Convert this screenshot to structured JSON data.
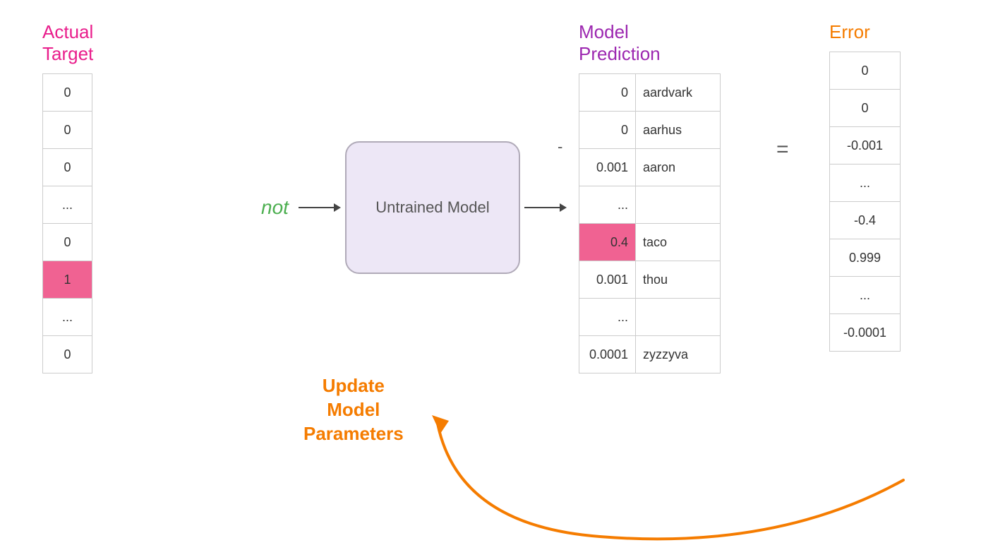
{
  "actualTarget": {
    "title": [
      "Actual",
      "Target"
    ],
    "rows": [
      {
        "value": "0",
        "highlighted": false
      },
      {
        "value": "0",
        "highlighted": false
      },
      {
        "value": "0",
        "highlighted": false
      },
      {
        "value": "...",
        "highlighted": false
      },
      {
        "value": "0",
        "highlighted": false
      },
      {
        "value": "1",
        "highlighted": true
      },
      {
        "value": "...",
        "highlighted": false
      },
      {
        "value": "0",
        "highlighted": false
      }
    ]
  },
  "model": {
    "inputWord": "not",
    "label": "Untrained Model"
  },
  "predictionHeader": [
    "Model",
    "Prediction"
  ],
  "predictionRows": [
    {
      "num": "0",
      "word": "aardvark",
      "highlighted": false
    },
    {
      "num": "0",
      "word": "aarhus",
      "highlighted": false
    },
    {
      "num": "0.001",
      "word": "aaron",
      "highlighted": false
    },
    {
      "num": "...",
      "word": "...",
      "highlighted": false
    },
    {
      "num": "0.4",
      "word": "taco",
      "highlighted": true
    },
    {
      "num": "0.001",
      "word": "thou",
      "highlighted": false
    },
    {
      "num": "...",
      "word": "...",
      "highlighted": false
    },
    {
      "num": "0.0001",
      "word": "zyzzyva",
      "highlighted": false
    }
  ],
  "errorHeader": "Error",
  "errorRows": [
    {
      "value": "0",
      "highlighted": false
    },
    {
      "value": "0",
      "highlighted": false
    },
    {
      "value": "-0.001",
      "highlighted": false
    },
    {
      "value": "...",
      "highlighted": false
    },
    {
      "value": "-0.4",
      "highlighted": false
    },
    {
      "value": "0.999",
      "highlighted": false
    },
    {
      "value": "...",
      "highlighted": false
    },
    {
      "value": "-0.0001",
      "highlighted": false
    }
  ],
  "updateParams": [
    "Update",
    "Model",
    "Parameters"
  ],
  "dashLabel": "-",
  "equalsLabel": "="
}
